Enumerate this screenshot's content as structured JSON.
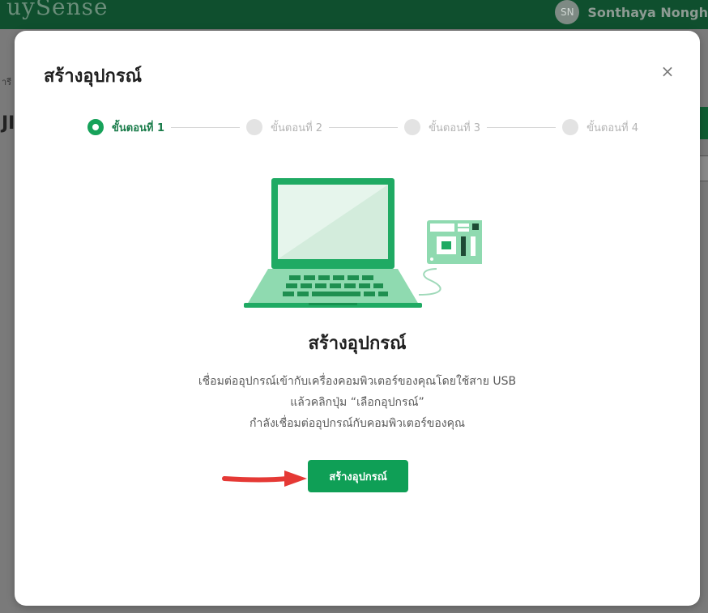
{
  "app": {
    "logo_text": "uySense",
    "avatar_initials": "SN",
    "user_name": "Sonthaya Nongh",
    "left_label": "ารี",
    "left_big": "JI"
  },
  "modal": {
    "title": "สร้างอุปกรณ์",
    "close_icon": "×",
    "steps": [
      {
        "label": "ขั้นตอนที่ 1",
        "active": true
      },
      {
        "label": "ขั้นตอนที่ 2",
        "active": false
      },
      {
        "label": "ขั้นตอนที่ 3",
        "active": false
      },
      {
        "label": "ขั้นตอนที่ 4",
        "active": false
      }
    ],
    "illustration": "laptop-with-device-board",
    "content_title": "สร้างอุปกรณ์",
    "description": [
      "เชื่อมต่ออุปกรณ์เข้ากับเครื่องคอมพิวเตอร์ของคุณโดยใช้สาย USB",
      "แล้วคลิกปุ่ม “เลือกอุปกรณ์”",
      "กำลังเชื่อมต่ออุปกรณ์กับคอมพิวเตอร์ของคุณ"
    ],
    "button_label": "สร้างอุปกรณ์"
  },
  "colors": {
    "accent": "#17a25a",
    "button": "#0f9f56",
    "arrow": "#e53935"
  }
}
